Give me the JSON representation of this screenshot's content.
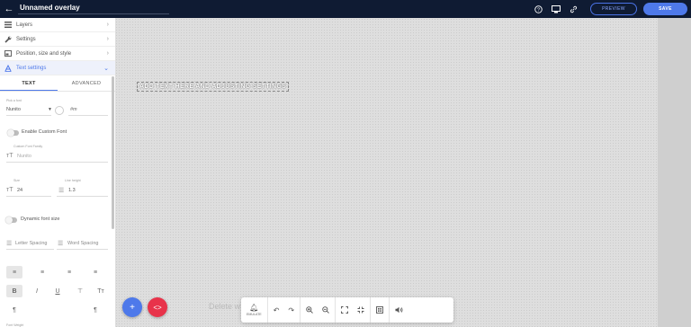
{
  "header": {
    "title": "Unnamed overlay",
    "preview_label": "PREVIEW",
    "save_label": "SAVE"
  },
  "sidebar": {
    "items": [
      {
        "label": "Layers",
        "icon": "layers-icon"
      },
      {
        "label": "Settings",
        "icon": "wrench-icon"
      },
      {
        "label": "Position, size and style",
        "icon": "position-icon"
      },
      {
        "label": "Text settings",
        "icon": "text-icon"
      }
    ],
    "tabs": [
      "TEXT",
      "ADVANCED"
    ],
    "font": {
      "label": "Pick a font",
      "value": "Nunito",
      "preview": "#m"
    },
    "custom_font": {
      "toggle_label": "Enable Custom Font",
      "field_label": "Custom Font Family",
      "placeholder": "Nunito"
    },
    "size": {
      "label": "Size",
      "value": "24"
    },
    "line_height": {
      "label": "Line height",
      "value": "1.3"
    },
    "dynamic_label": "Dynamic font size",
    "letter_spacing": "Letter Spacing",
    "word_spacing": "Word Spacing",
    "font_weight_label": "Font Weight"
  },
  "canvas": {
    "overlay_text": "ADD TEXT HERE AND ADJUSTING SETTINGS",
    "delete_hint": "Delete w"
  },
  "toolbar": {
    "emulate_label": "EMULATE"
  },
  "colors": {
    "topbar": "#0f1b33",
    "accent": "#4e79ea",
    "danger": "#e8334a"
  }
}
